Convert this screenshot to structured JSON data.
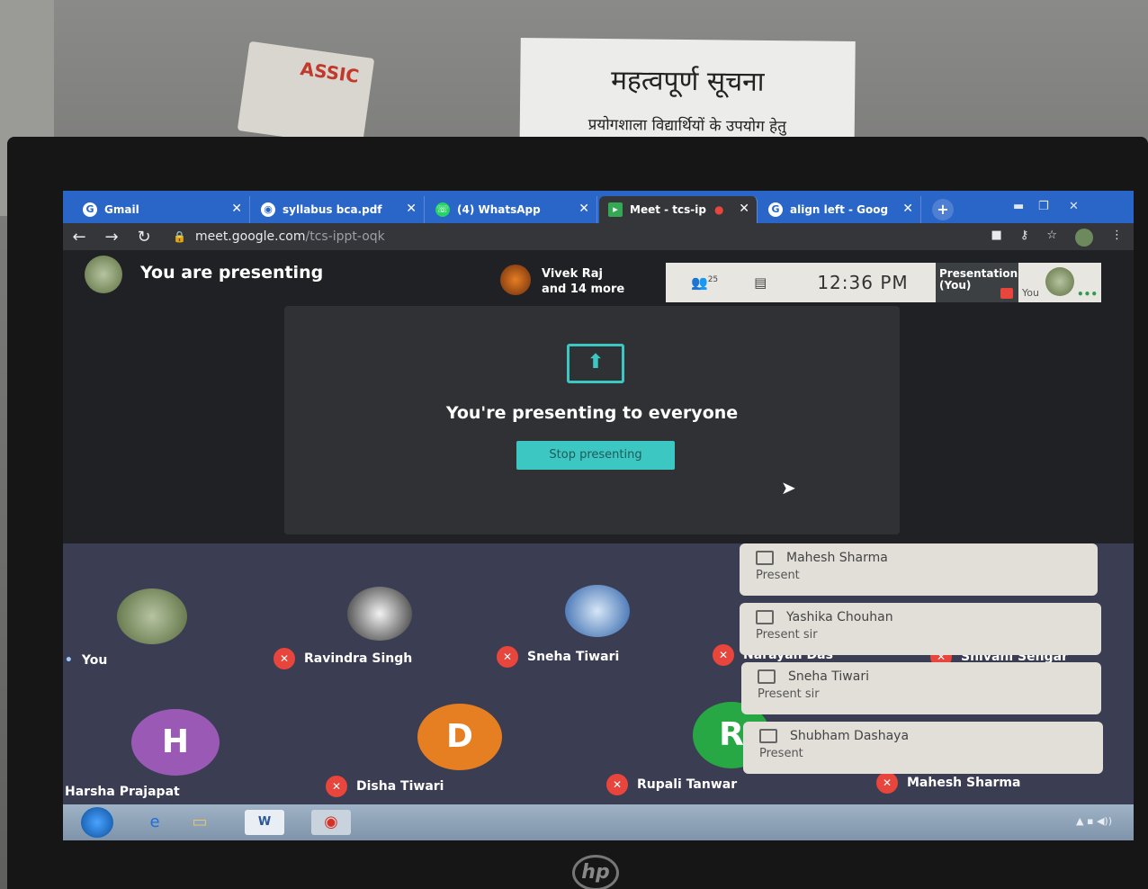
{
  "wall": {
    "sticker_text": "ASSIC",
    "notice_heading": "महत्वपूर्ण सूचना",
    "notice_line": "प्रयोगशाला विद्यार्थियों के उपयोग हेतु"
  },
  "browser": {
    "tabs": [
      {
        "label": "Gmail",
        "icon": "google-icon"
      },
      {
        "label": "syllabus bca.pdf",
        "icon": "chrome-icon"
      },
      {
        "label": "(4) WhatsApp",
        "icon": "whatsapp-icon"
      },
      {
        "label": "Meet - tcs-ipp",
        "icon": "meet-icon",
        "active": true
      },
      {
        "label": "align left - Google",
        "icon": "google-icon"
      }
    ],
    "url_host": "meet.google.com",
    "url_path": "/tcs-ippt-oqk"
  },
  "meet": {
    "presenting_title": "You are presenting",
    "others_line1": "Vivek Raj",
    "others_line2": "and 14 more",
    "people_count": "25",
    "clock": "12:36 PM",
    "presentation_chip": "Presentation (You)",
    "you_label": "You",
    "presenting_message": "You're presenting to everyone",
    "stop_button": "Stop presenting"
  },
  "participants": [
    {
      "name": "You",
      "muted": false
    },
    {
      "name": "Ravindra Singh",
      "muted": true
    },
    {
      "name": "Sneha Tiwari",
      "muted": true
    },
    {
      "name": "Narayan Das",
      "muted": true
    },
    {
      "name": "Shivani Sengar",
      "muted": true
    },
    {
      "name": "Harsha Prajapat",
      "muted": true,
      "initial": "H"
    },
    {
      "name": "Disha Tiwari",
      "muted": true,
      "initial": "D"
    },
    {
      "name": "Rupali Tanwar",
      "muted": true,
      "initial": "R"
    },
    {
      "name": "Mahesh Sharma",
      "muted": true
    }
  ],
  "chat_toasts": [
    {
      "sender": "Mahesh Sharma",
      "message": "Present"
    },
    {
      "sender": "Yashika Chouhan",
      "message": "Present sir"
    },
    {
      "sender": "Sneha Tiwari",
      "message": "Present sir"
    },
    {
      "sender": "Shubham Dashaya",
      "message": "Present"
    }
  ],
  "colors": {
    "tab_bar": "#2a66c7",
    "accent_teal": "#3cc7c3",
    "mic_off_red": "#e8453c",
    "avatar_h": "#9b59b6",
    "avatar_d": "#e67e22",
    "avatar_r": "#27a844"
  }
}
